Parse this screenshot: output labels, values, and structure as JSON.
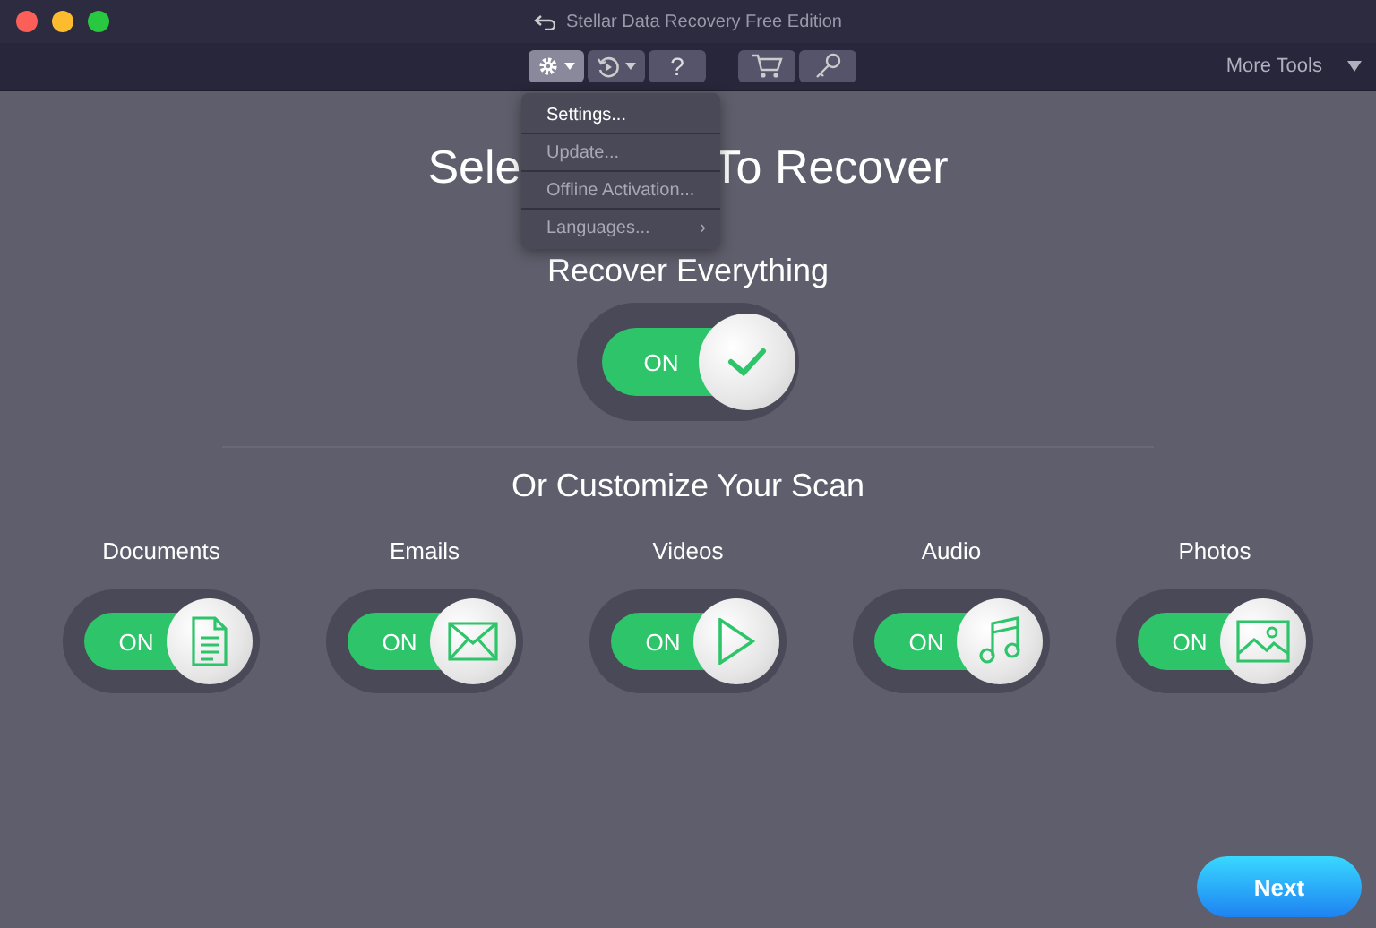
{
  "window": {
    "title": "Stellar Data Recovery Free Edition"
  },
  "toolbar": {
    "help": "?",
    "more_tools": "More Tools"
  },
  "settings_menu": [
    {
      "label": "Settings...",
      "disabled": false
    },
    {
      "label": "Update...",
      "disabled": true
    },
    {
      "label": "Offline Activation...",
      "disabled": true
    },
    {
      "label": "Languages...",
      "disabled": true,
      "submenu_arrow": "›"
    }
  ],
  "heading": {
    "start": "Sele",
    "end": "To Recover"
  },
  "recover_everything": {
    "label": "Recover Everything",
    "toggle": {
      "on": true,
      "text": "ON"
    }
  },
  "customize_heading": "Or Customize Your Scan",
  "categories": [
    {
      "kind": "document",
      "label": "Documents",
      "on": true,
      "text": "ON"
    },
    {
      "kind": "email",
      "label": "Emails",
      "on": true,
      "text": "ON"
    },
    {
      "kind": "video",
      "label": "Videos",
      "on": true,
      "text": "ON"
    },
    {
      "kind": "audio",
      "label": "Audio",
      "on": true,
      "text": "ON"
    },
    {
      "kind": "photo",
      "label": "Photos",
      "on": true,
      "text": "ON"
    }
  ],
  "next_button": "Next"
}
